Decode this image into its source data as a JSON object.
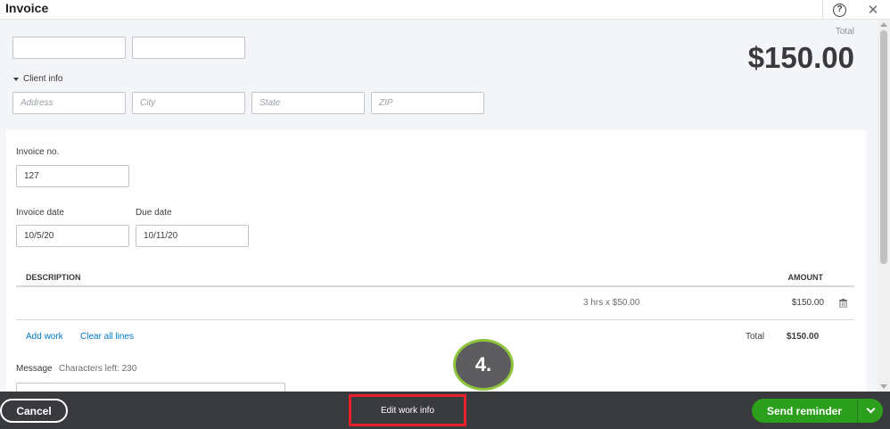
{
  "header": {
    "title": "Invoice",
    "help_icon": "question-circle-icon",
    "close_icon": "close-icon",
    "help_glyph": "?",
    "close_glyph": "✕"
  },
  "customer": {
    "field1_value": "",
    "field2_value": ""
  },
  "client_info": {
    "toggle_label": "Client info",
    "address_placeholder": "Address",
    "city_placeholder": "City",
    "state_placeholder": "State",
    "zip_placeholder": "ZIP"
  },
  "totals": {
    "label": "Total",
    "amount": "$150.00"
  },
  "invoice": {
    "number_label": "Invoice no.",
    "number_value": "127",
    "date_label": "Invoice date",
    "date_value": "10/5/20",
    "due_label": "Due date",
    "due_value": "10/11/20"
  },
  "table": {
    "headers": {
      "description": "DESCRIPTION",
      "amount": "AMOUNT"
    },
    "rows": [
      {
        "description": "",
        "detail": "3 hrs x $50.00",
        "amount": "$150.00"
      }
    ],
    "add_work": "Add work",
    "clear_lines": "Clear all lines",
    "total_label": "Total",
    "total_amount": "$150.00"
  },
  "message": {
    "label": "Message",
    "chars_left": "Characters left: 230"
  },
  "annotation": {
    "step_label": "4."
  },
  "footer": {
    "cancel": "Cancel",
    "edit_work_info": "Edit work info",
    "send_reminder": "Send reminder"
  },
  "colors": {
    "accent_green": "#2ca01c",
    "link_blue": "#0077c5",
    "highlight_red": "#e8202a",
    "footer_bg": "#393a3d"
  }
}
